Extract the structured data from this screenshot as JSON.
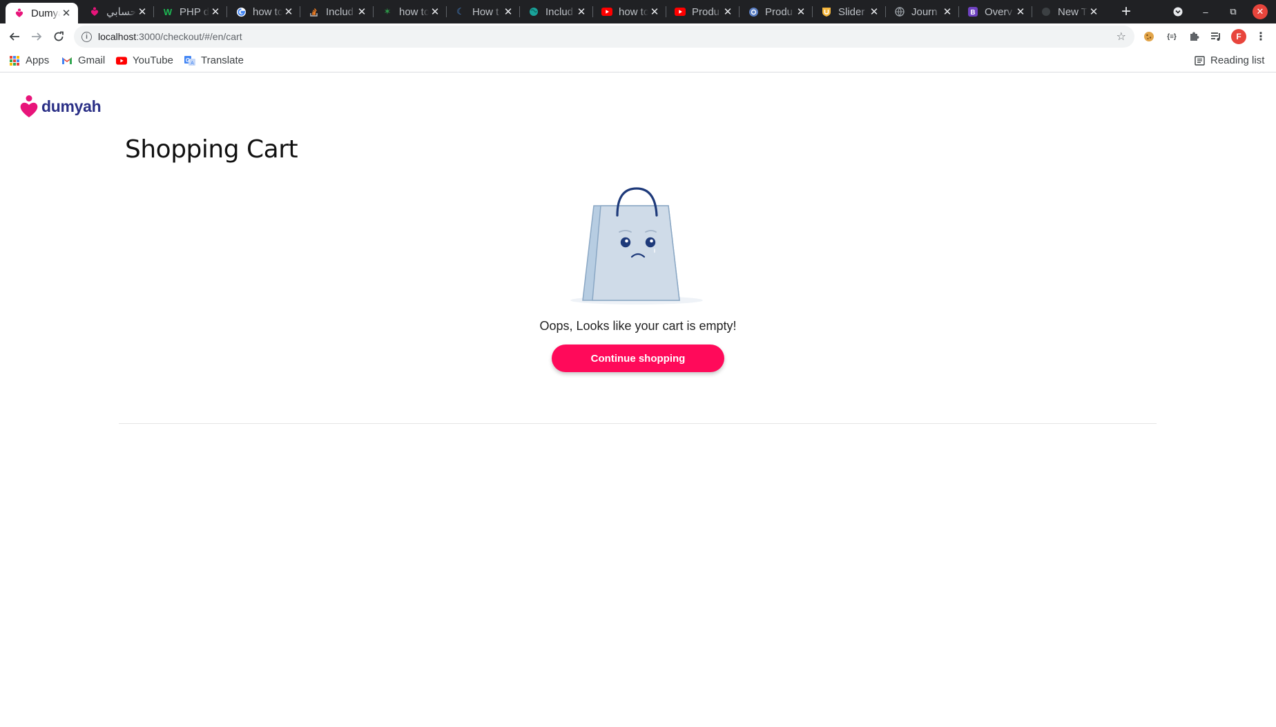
{
  "browser": {
    "tabs": [
      {
        "title": "Dumyah",
        "favicon": "dumyah-heart-icon",
        "active": true
      },
      {
        "title": "حسابي",
        "favicon": "dumyah-heart-icon"
      },
      {
        "title": "PHP d",
        "favicon": "w-logo-icon"
      },
      {
        "title": "how to",
        "favicon": "google-icon"
      },
      {
        "title": "Includ",
        "favicon": "stackoverflow-icon"
      },
      {
        "title": "how to",
        "favicon": "green-star-icon"
      },
      {
        "title": "How t",
        "favicon": "moon-icon"
      },
      {
        "title": "Includ",
        "favicon": "globe-icon"
      },
      {
        "title": "how to",
        "favicon": "youtube-icon"
      },
      {
        "title": "Produ",
        "favicon": "youtube-icon"
      },
      {
        "title": "Produ",
        "favicon": "helm-icon"
      },
      {
        "title": "Slider",
        "favicon": "shield-icon"
      },
      {
        "title": "Journ",
        "favicon": "globe-icon"
      },
      {
        "title": "Overv",
        "favicon": "bootstrap-icon"
      },
      {
        "title": "New T",
        "favicon": "newtab-icon"
      }
    ],
    "url_host": "localhost",
    "url_rest": ":3000/checkout/#/en/cart",
    "profile_initial": "F",
    "bookmarks": [
      {
        "label": "Apps",
        "icon": "apps-grid-icon"
      },
      {
        "label": "Gmail",
        "icon": "gmail-icon"
      },
      {
        "label": "YouTube",
        "icon": "youtube-icon"
      },
      {
        "label": "Translate",
        "icon": "translate-icon"
      }
    ],
    "reading_list_label": "Reading list"
  },
  "page": {
    "logo_text": "dumyah",
    "title": "Shopping Cart",
    "empty_message": "Oops, Looks like your cart is empty!",
    "cta_label": "Continue shopping"
  },
  "colors": {
    "brand_pink": "#ff0a5a",
    "logo_navy": "#2a2f86",
    "tab_bar": "#202124"
  }
}
